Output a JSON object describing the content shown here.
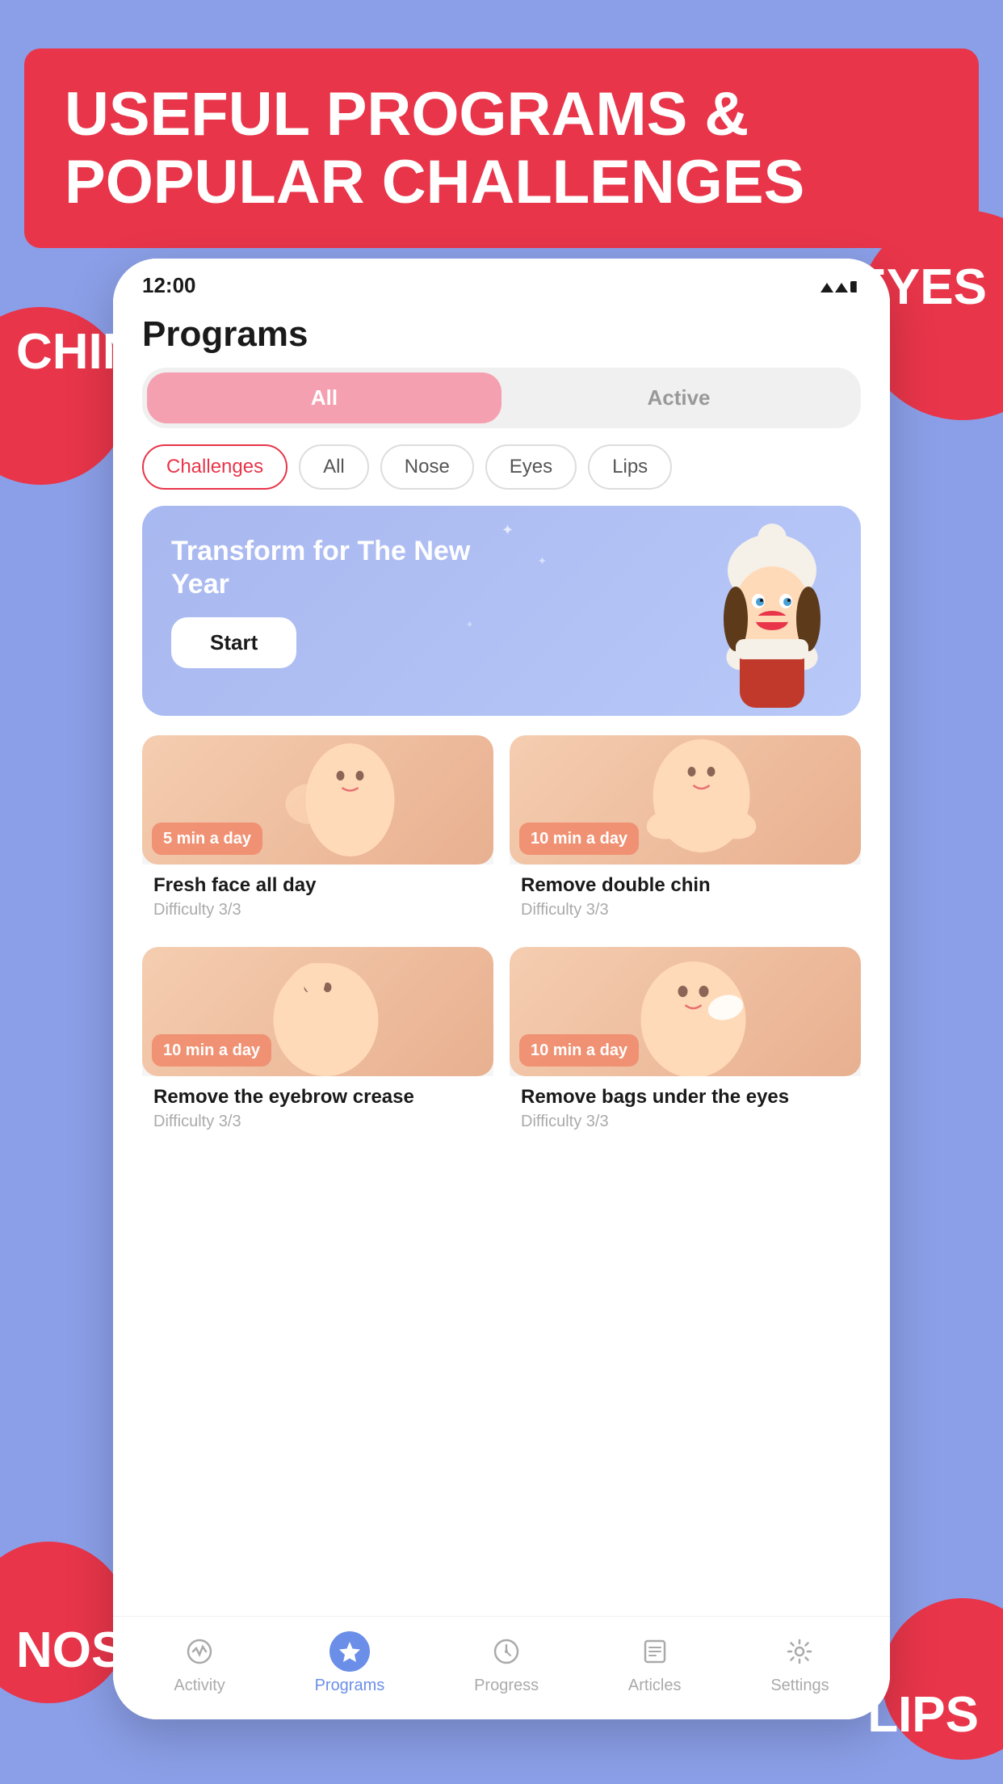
{
  "background_color": "#8B9FE8",
  "header": {
    "title_line1": "USEFUL PROGRAMS &",
    "title_line2": "POPULAR CHALLENGES"
  },
  "corner_labels": {
    "eyes": "EYES",
    "chin": "CHIN",
    "nose": "NOSE",
    "lips": "LIPS"
  },
  "phone": {
    "status_bar": {
      "time": "12:00",
      "signal": "▲▼▌"
    },
    "page_title": "Programs",
    "main_tabs": [
      {
        "label": "All",
        "active": true
      },
      {
        "label": "Active",
        "active": false
      }
    ],
    "filter_chips": [
      {
        "label": "Challenges",
        "selected": true
      },
      {
        "label": "All",
        "selected": false
      },
      {
        "label": "Nose",
        "selected": false
      },
      {
        "label": "Eyes",
        "selected": false
      },
      {
        "label": "Lips",
        "selected": false
      }
    ],
    "banner": {
      "text": "Transform for The New Year",
      "button_label": "Start"
    },
    "programs": [
      {
        "time": "5 min\na day",
        "name": "Fresh face all day",
        "difficulty": "Difficulty 3/3"
      },
      {
        "time": "10 min\na day",
        "name": "Remove double chin",
        "difficulty": "Difficulty 3/3"
      },
      {
        "time": "10 min\na day",
        "name": "Remove the eyebrow crease",
        "difficulty": "Difficulty 3/3"
      },
      {
        "time": "10 min\na day",
        "name": "Remove bags under the eyes",
        "difficulty": "Difficulty 3/3"
      }
    ],
    "bottom_nav": [
      {
        "label": "Activity",
        "active": false,
        "icon": "activity"
      },
      {
        "label": "Programs",
        "active": true,
        "icon": "star"
      },
      {
        "label": "Progress",
        "active": false,
        "icon": "progress"
      },
      {
        "label": "Articles",
        "active": false,
        "icon": "articles"
      },
      {
        "label": "Settings",
        "active": false,
        "icon": "settings"
      }
    ]
  }
}
